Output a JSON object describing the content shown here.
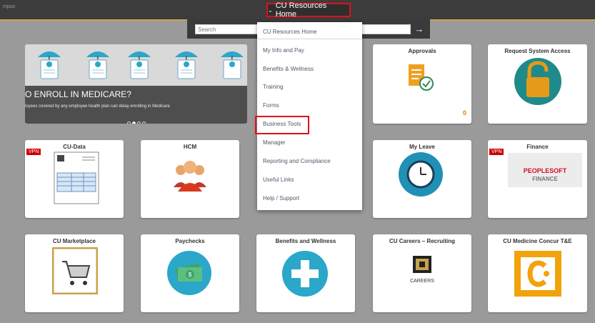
{
  "topbar": {
    "campus_label": "mpus"
  },
  "home_menu": {
    "label": "CU Resources Home"
  },
  "search": {
    "placeholder": "Search"
  },
  "menu": {
    "items": [
      {
        "label": "CU Resources Home"
      },
      {
        "label": "My Info and Pay"
      },
      {
        "label": "Benefits & Wellness"
      },
      {
        "label": "Training"
      },
      {
        "label": "Forms"
      },
      {
        "label": "Business Tools"
      },
      {
        "label": "Manager"
      },
      {
        "label": "Reporting and Compliance"
      },
      {
        "label": "Useful Links"
      },
      {
        "label": "Help / Support"
      }
    ],
    "highlighted": "Business Tools"
  },
  "carousel": {
    "headline": "O ENROLL IN MEDICARE?",
    "subtext": "loyees covered by any employee health plan can delay enrolling in Medicare",
    "active_dot": 2,
    "dot_count": 4
  },
  "tiles": {
    "approvals": {
      "title": "Approvals",
      "count": "0"
    },
    "request_access": {
      "title": "Request System Access"
    },
    "cu_data": {
      "title": "CU-Data",
      "vpn": "VPN"
    },
    "hcm": {
      "title": "HCM"
    },
    "my_leave": {
      "title": "My Leave"
    },
    "finance": {
      "title": "Finance",
      "vpn": "VPN",
      "brand_line1": "PEOPLESOFT",
      "brand_line2": "FINANCE"
    },
    "cu_marketplace": {
      "title": "CU Marketplace"
    },
    "paychecks": {
      "title": "Paychecks"
    },
    "benefits": {
      "title": "Benefits and Wellness"
    },
    "careers": {
      "title": "CU Careers – Recruiting",
      "caption": "CAREERS"
    },
    "concur": {
      "title": "CU Medicine Concur T&E"
    }
  },
  "colors": {
    "highlight_red": "#e0101a",
    "teal": "#2aa7c9",
    "gold_brand": "#c8a44a",
    "peoplesoft_red": "#cc1122"
  }
}
